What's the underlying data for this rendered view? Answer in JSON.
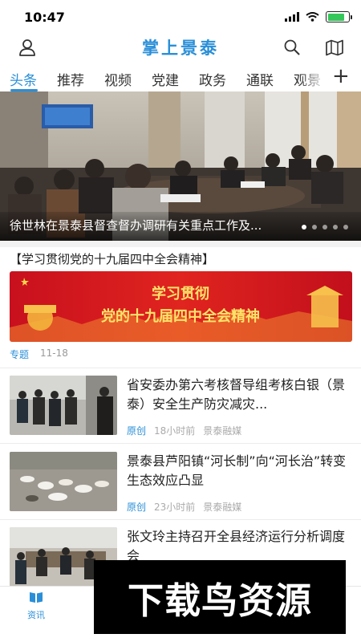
{
  "status_bar": {
    "time": "10:47",
    "battery_level": 0.8
  },
  "header": {
    "title": "掌上景泰",
    "icons": [
      "user-icon",
      "search-icon",
      "map-icon"
    ],
    "accent_color": "#2a8fd8"
  },
  "tabs": {
    "items": [
      "头条",
      "推荐",
      "视频",
      "党建",
      "政务",
      "通联",
      "观景"
    ],
    "active_index": 0,
    "add_icon": "plus-icon"
  },
  "hero": {
    "caption": "徐世林在景泰县督查督办调研有关重点工作及...",
    "page_count": 5,
    "active_page": 0
  },
  "special": {
    "heading": "【学习贯彻党的十九届四中全会精神】",
    "banner_line1": "学习贯彻",
    "banner_line2": "党的十九届四中全会精神",
    "topic_label": "专题",
    "date": "11-18"
  },
  "news": [
    {
      "title": "省安委办第六考核督导组考核白银（景泰）安全生产防灾减灾...",
      "origin": "原创",
      "time": "18小时前",
      "source": "景泰融媒"
    },
    {
      "title": "景泰县芦阳镇“河长制”向“河长治”转变生态效应凸显",
      "origin": "原创",
      "time": "23小时前",
      "source": "景泰融媒"
    },
    {
      "title": "张文玲主持召开全县经济运行分析调度会",
      "origin": "",
      "time": "",
      "source": ""
    }
  ],
  "bottom_nav": {
    "news_label": "资讯",
    "news_icon": "book-icon"
  },
  "watermark": {
    "text": "下载鸟资源"
  }
}
